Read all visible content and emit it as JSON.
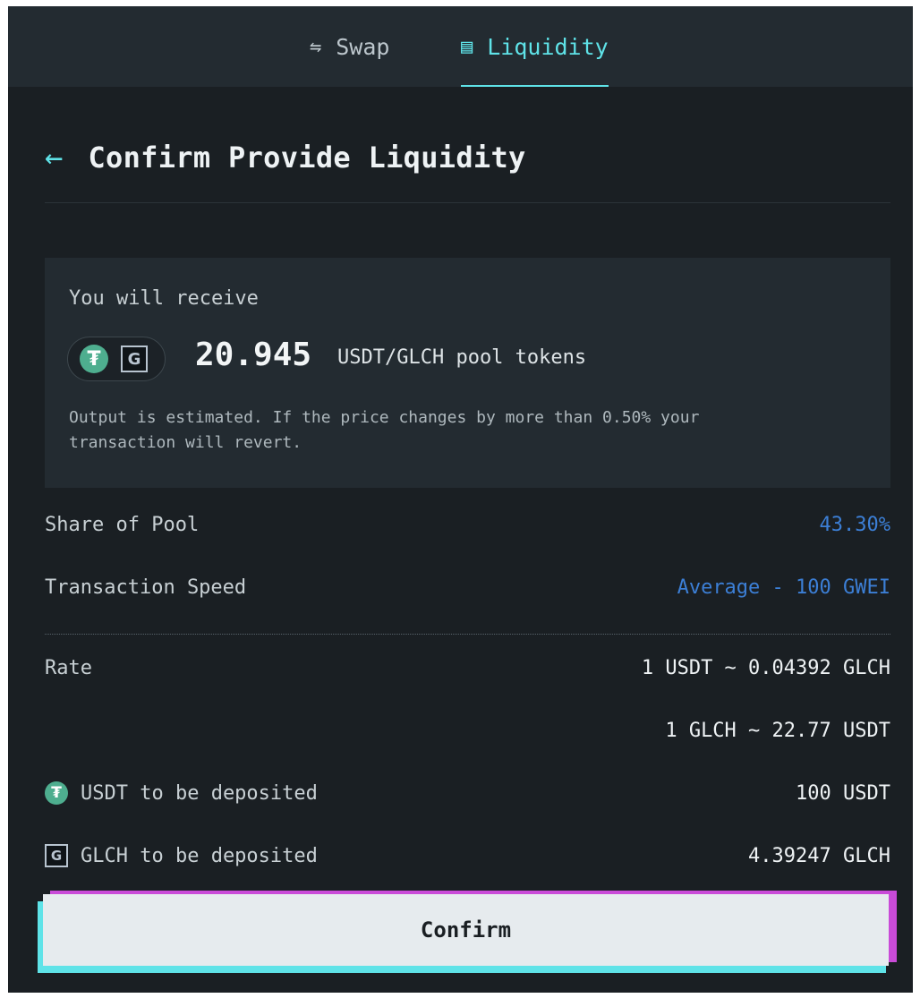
{
  "tabs": {
    "swap": {
      "label": "Swap",
      "icon": "⇋"
    },
    "liquidity": {
      "label": "Liquidity",
      "icon": "▤"
    }
  },
  "header": {
    "title": "Confirm Provide Liquidity",
    "back_icon": "←"
  },
  "receive": {
    "label": "You will receive",
    "amount": "20.945",
    "unit": "USDT/GLCH pool tokens",
    "note": "Output is estimated. If the price changes by more than 0.50% your transaction will revert."
  },
  "details": {
    "share_label": "Share of Pool",
    "share_value": "43.30%",
    "speed_label": "Transaction Speed",
    "speed_value": "Average - 100 GWEI",
    "rate_label": "Rate",
    "rate_1": "1 USDT ~ 0.04392 GLCH",
    "rate_2": "1 GLCH ~ 22.77 USDT",
    "usdt_label": "USDT to be deposited",
    "usdt_value": "100 USDT",
    "glch_label": "GLCH to be deposited",
    "glch_value": "4.39247 GLCH"
  },
  "icons": {
    "usdt": "₮",
    "glch": "G"
  },
  "confirm": {
    "label": "Confirm"
  },
  "colors": {
    "accent": "#5fe3e8",
    "link_blue": "#3c7fd6",
    "magenta": "#c94bd8",
    "bg": "#1a1f23"
  }
}
